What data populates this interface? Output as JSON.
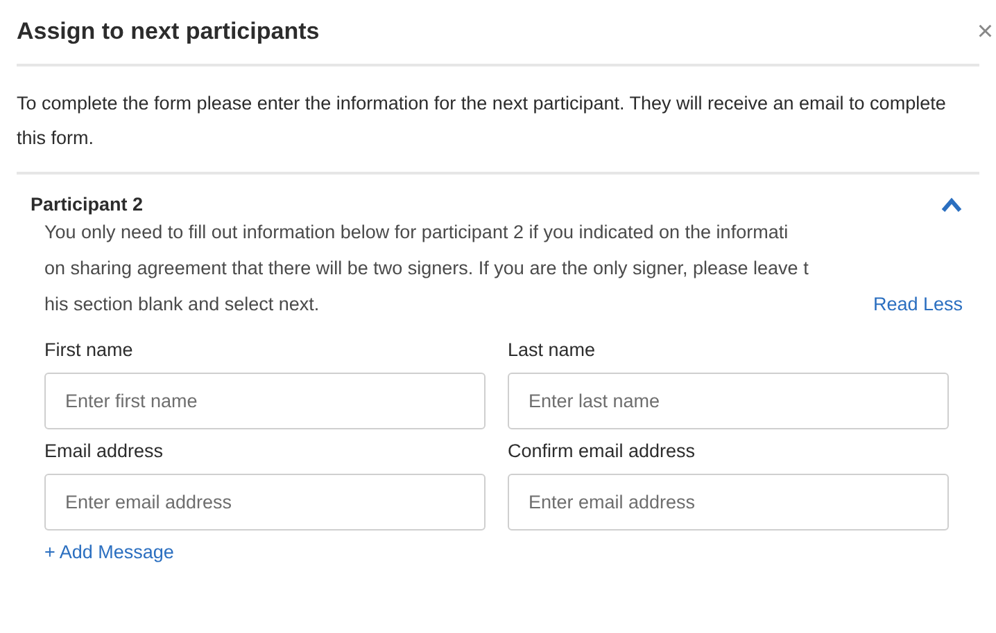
{
  "dialog": {
    "title": "Assign to next participants",
    "close": "×",
    "intro": "To complete the form please enter the information for the next participant. They will receive an email to complete this form."
  },
  "participant": {
    "title": "Participant 2",
    "expanded": true,
    "description_lines": [
      "You only need to fill out information below for participant 2 if you indicated on the informati",
      "on sharing agreement that there will be two signers. If you are the only signer, please leave t",
      "his section blank and select next."
    ],
    "read_less": "Read Less",
    "fields": [
      {
        "label": "First name",
        "placeholder": "Enter first name"
      },
      {
        "label": "Last name",
        "placeholder": "Enter last name"
      },
      {
        "label": "Email address",
        "placeholder": "Enter email address"
      },
      {
        "label": "Confirm email address",
        "placeholder": "Enter email address"
      }
    ],
    "add_message": "+ Add Message"
  }
}
